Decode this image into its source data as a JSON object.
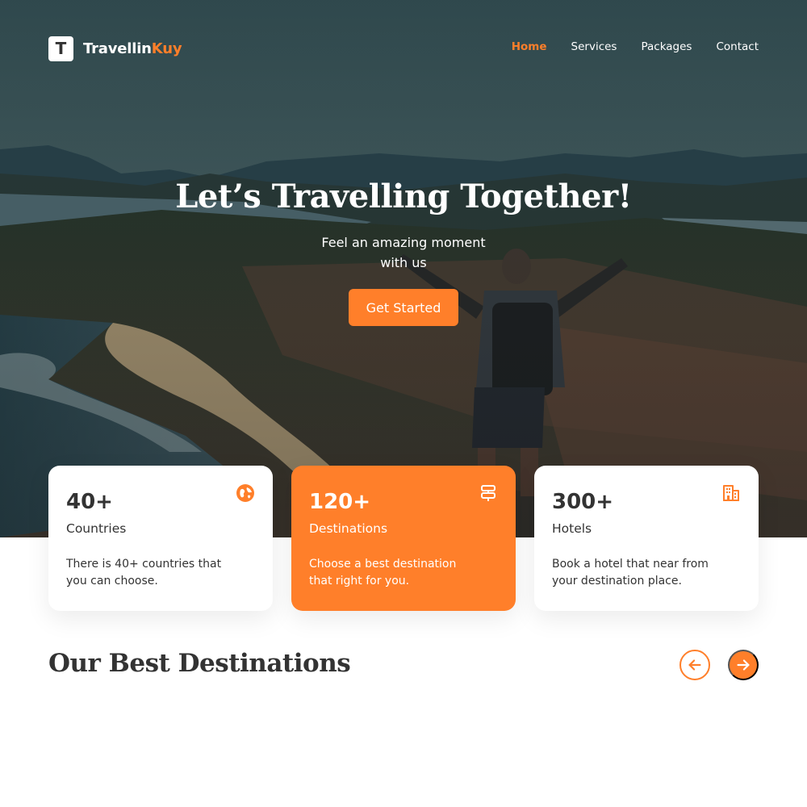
{
  "brand": {
    "logo_letter": "T",
    "name_part1": "Travellin",
    "name_part2": "Kuy",
    "accent_color": "#ff7f2a"
  },
  "nav": {
    "items": [
      {
        "label": "Home",
        "active": true
      },
      {
        "label": "Services",
        "active": false
      },
      {
        "label": "Packages",
        "active": false
      },
      {
        "label": "Contact",
        "active": false
      }
    ]
  },
  "hero": {
    "title": "Let’s Travelling Together!",
    "subtitle_line1": "Feel an amazing moment",
    "subtitle_line2": "with us",
    "cta_label": "Get Started"
  },
  "stats": [
    {
      "value": "40+",
      "label": "Countries",
      "desc_line1": "There is 40+ countries that",
      "desc_line2": "you can choose.",
      "icon": "globe-icon"
    },
    {
      "value": "120+",
      "label": "Destinations",
      "desc_line1": "Choose a best destination",
      "desc_line2": "that right for you.",
      "icon": "signpost-icon"
    },
    {
      "value": "300+",
      "label": "Hotels",
      "desc_line1": "Book a hotel that near from",
      "desc_line2": "your destination place.",
      "icon": "building-icon"
    }
  ],
  "destinations": {
    "title": "Our Best Destinations",
    "prev_icon": "arrow-left-icon",
    "next_icon": "arrow-right-icon"
  }
}
